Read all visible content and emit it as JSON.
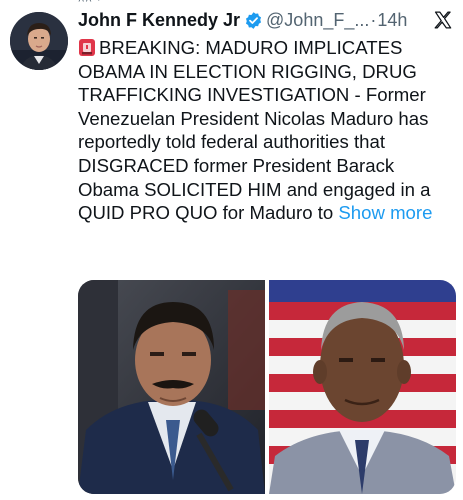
{
  "tweet": {
    "author_name": "John F Kennedy Jr",
    "handle": "@John_F_...",
    "separator": "·",
    "time": "14h",
    "verified": true,
    "text_emoji": "rotating-light-emoji",
    "text": "BREAKING: MADURO IMPLICATES OBAMA IN ELECTION RIGGING, DRUG TRAFFICKING INVESTIGATION - Former Venezuelan President Nicolas Maduro has reportedly told federal authorities that DISGRACED former President Barack Obama SOLICITED HIM and engaged in a QUID PRO QUO for Maduro to",
    "show_more": "Show more",
    "media": [
      {
        "icon": "photo-man-at-microphone"
      },
      {
        "icon": "photo-man-in-front-of-flag"
      }
    ]
  },
  "colors": {
    "text": "#0f1419",
    "secondary": "#536471",
    "link": "#1d9bf0",
    "verified": "#1d9bf0",
    "background": "#ffffff"
  }
}
